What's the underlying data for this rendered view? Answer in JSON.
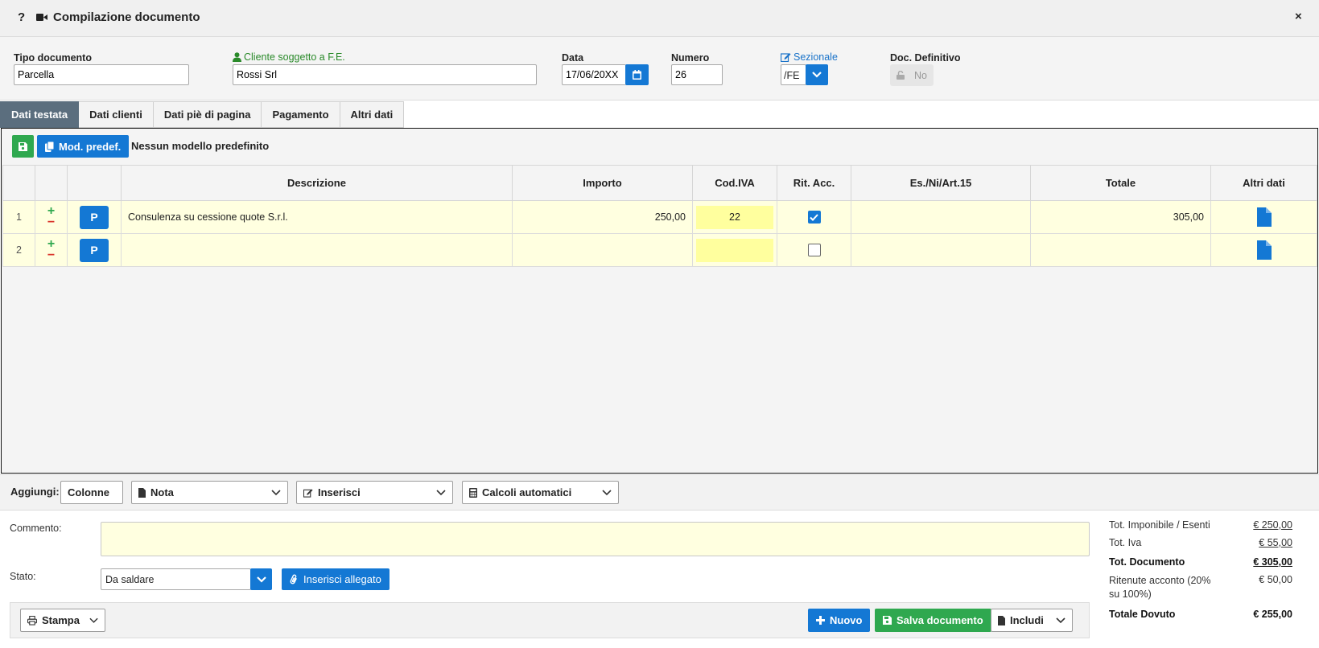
{
  "window": {
    "title": "Compilazione documento",
    "help_glyph": "?",
    "close_glyph": "×"
  },
  "header": {
    "tipo_documento": {
      "label": "Tipo documento",
      "value": "Parcella"
    },
    "cliente": {
      "label": "Cliente soggetto a F.E.",
      "value": "Rossi Srl"
    },
    "data": {
      "label": "Data",
      "value": "17/06/20XX"
    },
    "numero": {
      "label": "Numero",
      "value": "26"
    },
    "sezionale": {
      "label": "Sezionale",
      "value": "/FE"
    },
    "doc_definitivo": {
      "label": "Doc. Definitivo",
      "value": "No"
    }
  },
  "tabs": [
    "Dati testata",
    "Dati clienti",
    "Dati piè di pagina",
    "Pagamento",
    "Altri dati"
  ],
  "toolbar": {
    "mod_predef_label": "Mod. predef.",
    "model_status": "Nessun modello predefinito"
  },
  "grid": {
    "columns": [
      "Descrizione",
      "Importo",
      "Cod.IVA",
      "Rit. Acc.",
      "Es./Ni/Art.15",
      "Totale",
      "Altri dati"
    ],
    "rows": [
      {
        "num": "1",
        "p": "P",
        "descrizione": "Consulenza su cessione quote S.r.l.",
        "importo": "250,00",
        "cod_iva": "22",
        "rit_acc": true,
        "es": "",
        "totale": "305,00"
      },
      {
        "num": "2",
        "p": "P",
        "descrizione": "",
        "importo": "",
        "cod_iva": "",
        "rit_acc": false,
        "es": "",
        "totale": ""
      }
    ]
  },
  "aggiungi": {
    "label": "Aggiungi:",
    "colonne": "Colonne",
    "nota": "Nota",
    "inserisci": "Inserisci",
    "calcoli": "Calcoli automatici"
  },
  "footer": {
    "commento_label": "Commento:",
    "commento_value": "",
    "stato_label": "Stato:",
    "stato_value": "Da saldare",
    "allegato_label": "Inserisci allegato",
    "stampa_label": "Stampa",
    "nuovo_label": "Nuovo",
    "salva_label": "Salva documento",
    "includi_label": "Includi"
  },
  "totals": {
    "imponibile_label": "Tot. Imponibile / Esenti",
    "imponibile_value": "€ 250,00",
    "iva_label": "Tot. Iva",
    "iva_value": "€ 55,00",
    "documento_label": "Tot. Documento",
    "documento_value": "€ 305,00",
    "ritenute_label": "Ritenute acconto (20% su 100%)",
    "ritenute_value": "€ 50,00",
    "dovuto_label": "Totale Dovuto",
    "dovuto_value": "€ 255,00"
  },
  "colors": {
    "primary": "#1478d4",
    "success": "#2fa84f",
    "danger": "#d9342b",
    "highlight": "#ffffe0",
    "tab_active": "#5b6e7e"
  }
}
